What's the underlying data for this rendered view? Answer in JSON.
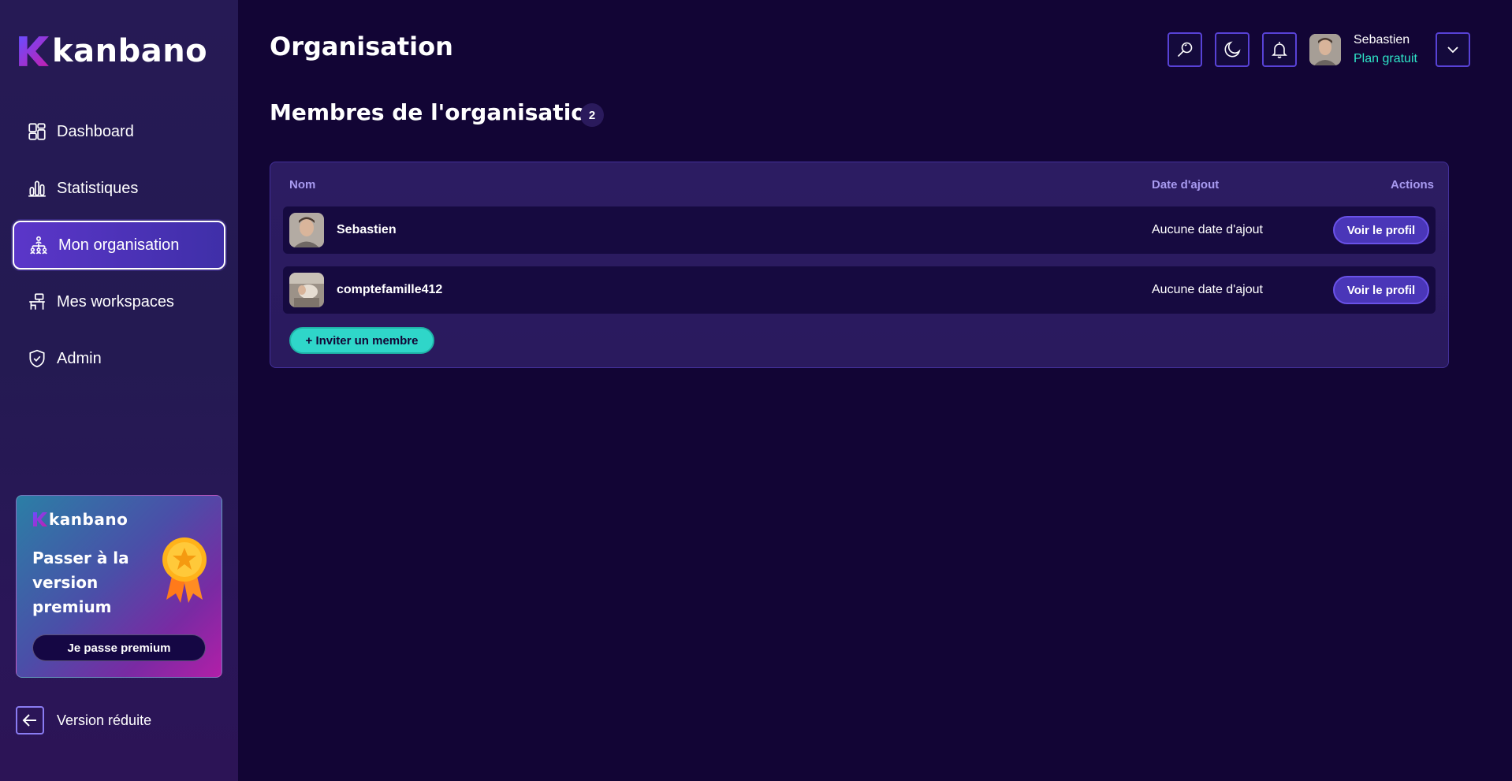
{
  "app": {
    "name": "kanbano"
  },
  "sidebar": {
    "items": [
      {
        "label": "Dashboard",
        "icon": "dashboard-icon"
      },
      {
        "label": "Statistiques",
        "icon": "bar-chart-icon"
      },
      {
        "label": "Mon organisation",
        "icon": "organization-icon",
        "active": true
      },
      {
        "label": "Mes workspaces",
        "icon": "workspace-icon"
      },
      {
        "label": "Admin",
        "icon": "shield-check-icon"
      }
    ],
    "premium": {
      "logo": "kanbano",
      "title": "Passer à la version premium",
      "button": "Je passe premium",
      "icon": "medal-icon"
    },
    "collapse_label": "Version réduite"
  },
  "header": {
    "title": "Organisation",
    "user": {
      "name": "Sebastien",
      "plan": "Plan gratuit"
    },
    "icons": [
      "search-icon",
      "moon-icon",
      "bell-icon",
      "chevron-down-icon"
    ]
  },
  "members": {
    "title": "Membres de l'organisation",
    "count": "2",
    "columns": {
      "name": "Nom",
      "date": "Date d'ajout",
      "actions": "Actions"
    },
    "rows": [
      {
        "name": "Sebastien",
        "date": "Aucune date d'ajout",
        "action": "Voir le profil"
      },
      {
        "name": "comptefamille412",
        "date": "Aucune date d'ajout",
        "action": "Voir le profil"
      }
    ],
    "invite_label": "+ Inviter un membre"
  },
  "colors": {
    "background": "#120535",
    "sidebar": "#261a55",
    "accent": "#5842d6",
    "teal": "#2ee6c8"
  }
}
